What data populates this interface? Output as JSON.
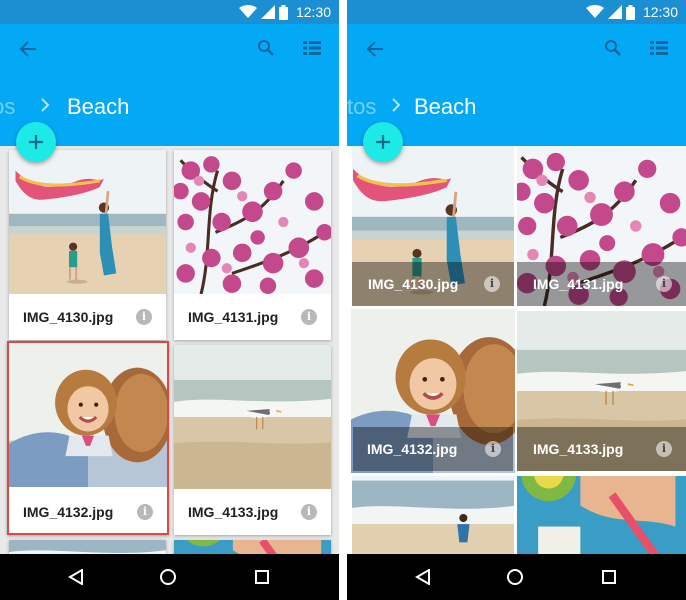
{
  "colors": {
    "status_bar": "#1b8fd2",
    "app_bar": "#03a9f4",
    "fab": "#1de9e6",
    "selected_card_outline": "#d84a47",
    "selected_tile_outline": "#1f5a25"
  },
  "left_screen": {
    "status": {
      "time": "12:30",
      "icons": [
        "wifi-icon",
        "signal-icon",
        "battery-icon"
      ]
    },
    "app_bar": {
      "back_icon": "arrow-back-icon",
      "actions": [
        "search-icon",
        "view-list-icon"
      ],
      "breadcrumb_previous": "tos",
      "breadcrumb_separator_icon": "chevron-right-icon",
      "breadcrumb_current": "Beach"
    },
    "fab_icon": "plus-icon",
    "layout": "cards",
    "items": [
      {
        "caption": "IMG_4130.jpg",
        "info_icon": "info-icon",
        "selected": false
      },
      {
        "caption": "IMG_4131.jpg",
        "info_icon": "info-icon",
        "selected": false
      },
      {
        "caption": "IMG_4132.jpg",
        "info_icon": "info-icon",
        "selected": true
      },
      {
        "caption": "IMG_4133.jpg",
        "info_icon": "info-icon",
        "selected": false
      }
    ],
    "nav": [
      "back-triangle-icon",
      "home-circle-icon",
      "recents-square-icon"
    ]
  },
  "right_screen": {
    "status": {
      "time": "12:30",
      "icons": [
        "wifi-icon",
        "signal-icon",
        "battery-icon"
      ]
    },
    "app_bar": {
      "back_icon": "arrow-back-icon",
      "actions": [
        "search-icon",
        "view-list-icon"
      ],
      "breadcrumb_previous": "tos",
      "breadcrumb_separator_icon": "chevron-right-icon",
      "breadcrumb_current": "Beach"
    },
    "fab_icon": "plus-icon",
    "layout": "tiles",
    "items": [
      {
        "caption": "IMG_4130.jpg",
        "info_icon": "info-icon",
        "selected": false
      },
      {
        "caption": "IMG_4131.jpg",
        "info_icon": "info-icon",
        "selected": false
      },
      {
        "caption": "IMG_4132.jpg",
        "info_icon": "info-icon",
        "selected": true
      },
      {
        "caption": "IMG_4133.jpg",
        "info_icon": "info-icon",
        "selected": false
      }
    ],
    "nav": [
      "back-triangle-icon",
      "home-circle-icon",
      "recents-square-icon"
    ]
  }
}
